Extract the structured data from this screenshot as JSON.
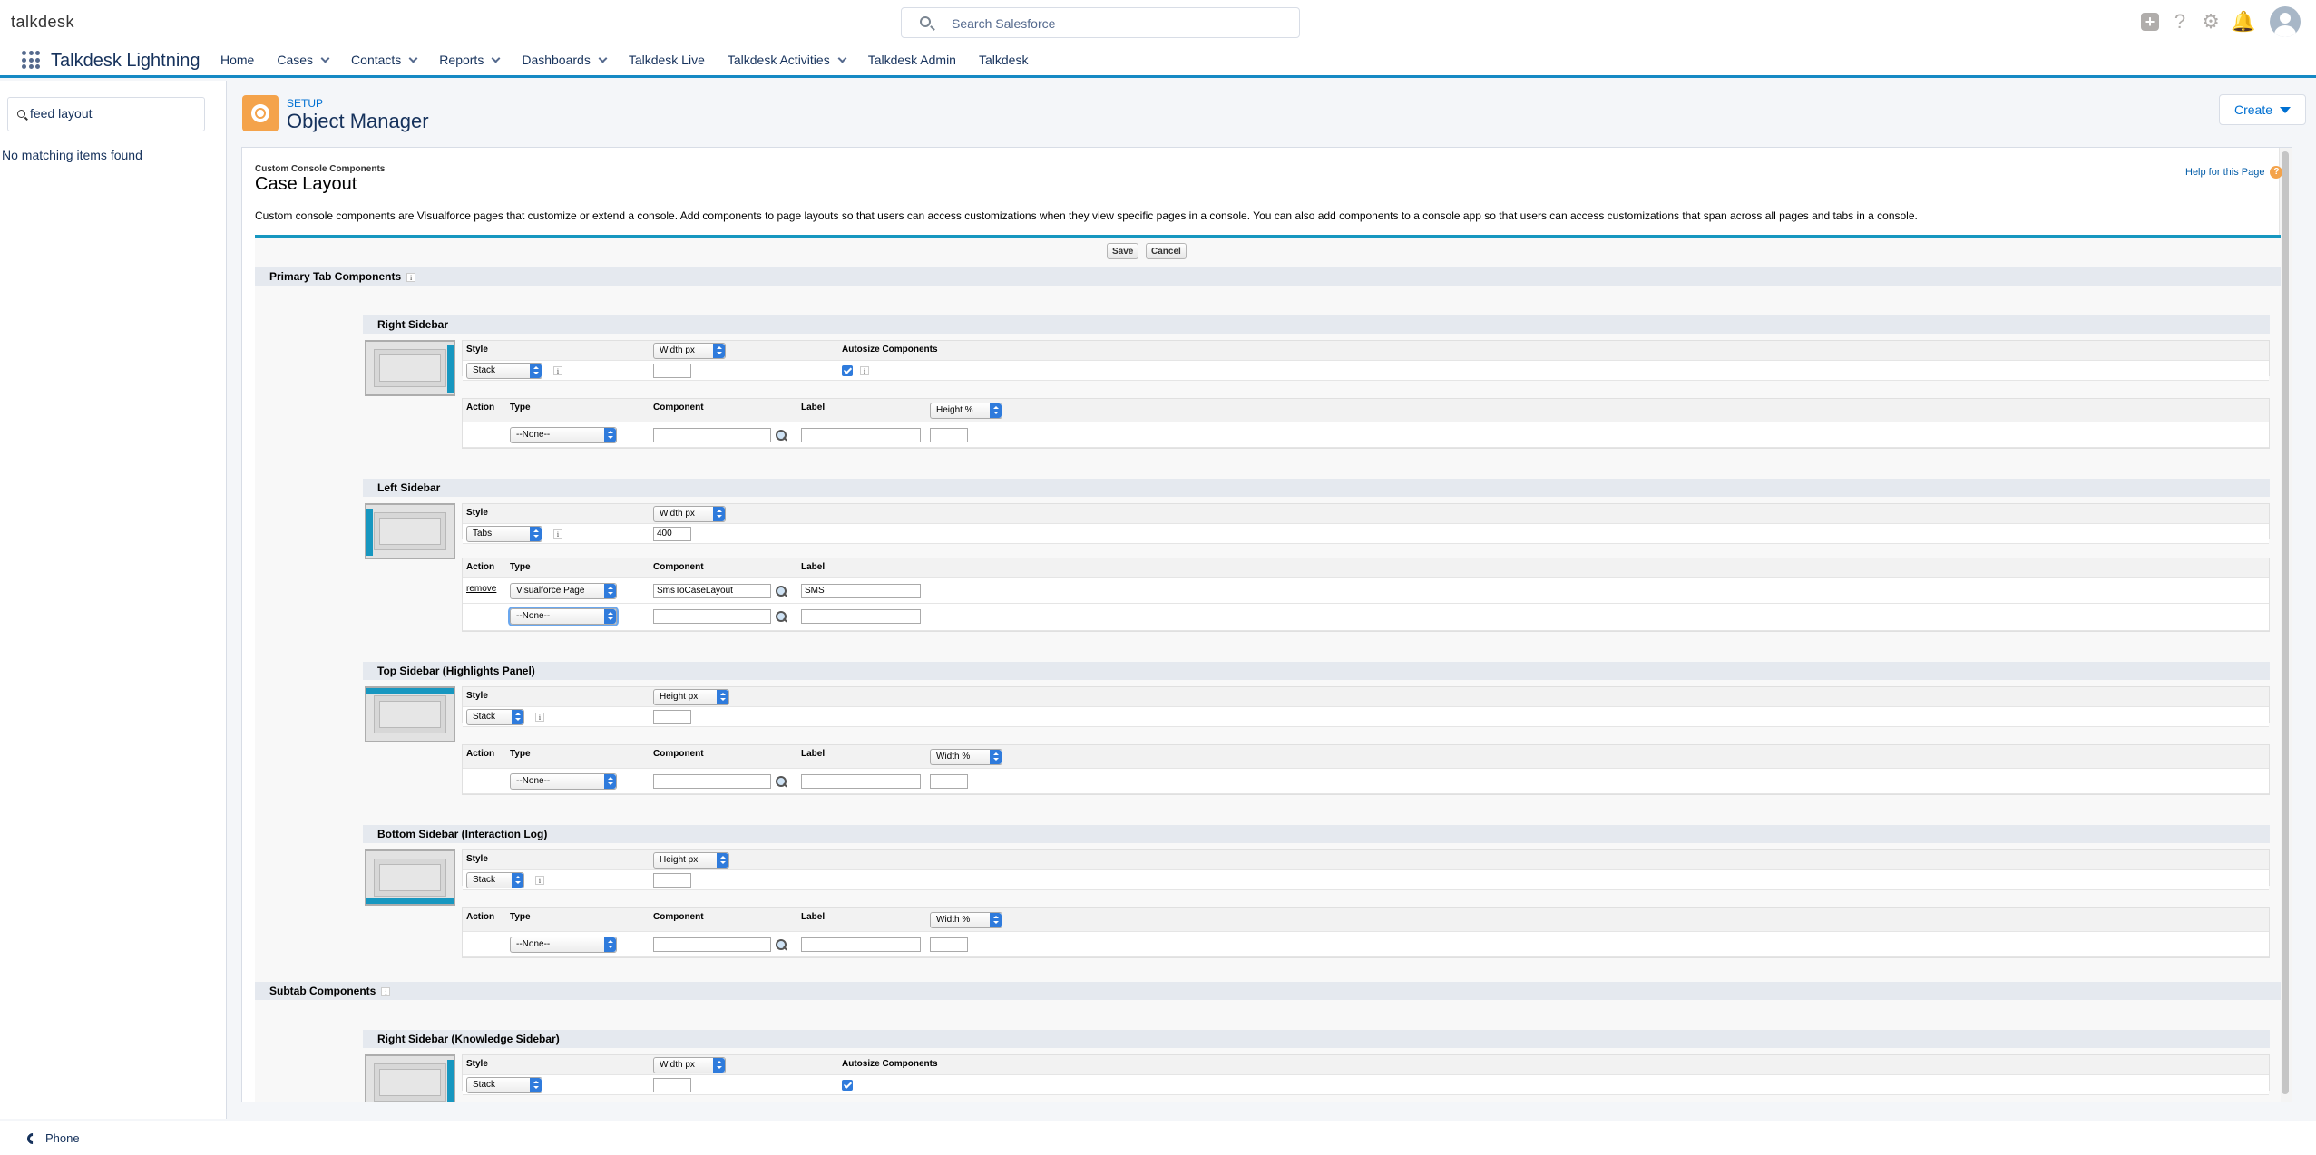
{
  "topbar": {
    "logo": "talkdesk",
    "search_placeholder": "Search Salesforce"
  },
  "nav": {
    "app_name": "Talkdesk Lightning",
    "items": [
      {
        "label": "Home",
        "chevron": false
      },
      {
        "label": "Cases",
        "chevron": true
      },
      {
        "label": "Contacts",
        "chevron": true
      },
      {
        "label": "Reports",
        "chevron": true
      },
      {
        "label": "Dashboards",
        "chevron": true
      },
      {
        "label": "Talkdesk Live",
        "chevron": false
      },
      {
        "label": "Talkdesk Activities",
        "chevron": true
      },
      {
        "label": "Talkdesk Admin",
        "chevron": false
      },
      {
        "label": "Talkdesk",
        "chevron": false
      }
    ]
  },
  "sidebar": {
    "quickfind_value": "feed layout",
    "no_match": "No matching items found"
  },
  "setup": {
    "label": "SETUP",
    "title": "Object Manager",
    "create": "Create"
  },
  "page": {
    "small_title": "Custom Console Components",
    "title": "Case Layout",
    "help": "Help for this Page",
    "help_icon": "?",
    "description": "Custom console components are Visualforce pages that customize or extend a console. Add components to page layouts so that users can access customizations when they view specific pages in a console. You can also add components to a console app so that users can access customizations that span across all pages and tabs in a console.",
    "save": "Save",
    "cancel": "Cancel"
  },
  "labels": {
    "style": "Style",
    "autosize": "Autosize Components",
    "action": "Action",
    "type": "Type",
    "component": "Component",
    "label": "Label",
    "remove": "remove",
    "info": "i"
  },
  "sections": {
    "primary": "Primary Tab Components",
    "subtab": "Subtab Components"
  },
  "right": {
    "title": "Right Sidebar",
    "style": "Stack",
    "dim": "Width px",
    "dim_value": "",
    "size_sel": "Height %",
    "type": "--None--"
  },
  "left": {
    "title": "Left Sidebar",
    "style": "Tabs",
    "dim": "Width px",
    "dim_value": "400",
    "rows": [
      {
        "type": "Visualforce Page",
        "component": "SmsToCaseLayout",
        "label": "SMS"
      },
      {
        "type": "--None--",
        "component": "",
        "label": ""
      }
    ]
  },
  "top": {
    "title": "Top Sidebar (Highlights Panel)",
    "style": "Stack",
    "dim": "Height px",
    "size_sel": "Width %",
    "type": "--None--"
  },
  "bottom": {
    "title": "Bottom Sidebar (Interaction Log)",
    "style": "Stack",
    "dim": "Height px",
    "size_sel": "Width %",
    "type": "--None--"
  },
  "knowledge": {
    "title": "Right Sidebar (Knowledge Sidebar)",
    "style": "Stack",
    "dim": "Width px"
  },
  "footer": {
    "phone": "Phone"
  }
}
